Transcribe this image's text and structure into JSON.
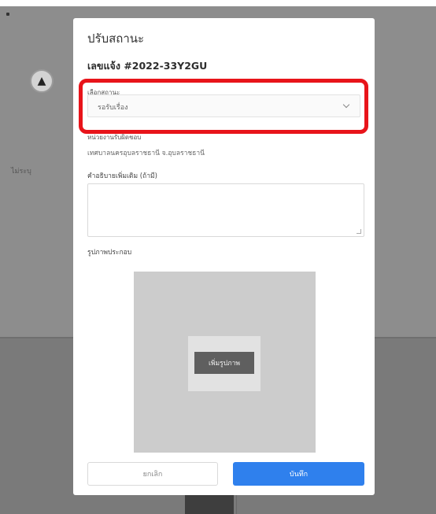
{
  "background": {
    "side_label": "ไม่ระบุ",
    "bell_icon": "bell-icon"
  },
  "modal": {
    "title": "ปรับสถานะ",
    "subtitle": "เลขแจ้ง #2022-33Y2GU",
    "status_label": "เลือกสถานะ",
    "status_value": "รอรับเรื่อง",
    "agency_label": "หน่วยงานรับผิดชอบ",
    "agency_value": "เทศบาลนครอุบลราชธานี จ.อุบลราชธานี",
    "note_label": "คำอธิบายเพิ่มเติม (ถ้ามี)",
    "note_value": "",
    "image_label": "รูปภาพประกอบ",
    "add_image_label": "เพิ่มรูปภาพ",
    "cancel_label": "ยกเลิก",
    "save_label": "บันทึก"
  },
  "colors": {
    "primary": "#2f80ed",
    "highlight": "#e8141a"
  }
}
